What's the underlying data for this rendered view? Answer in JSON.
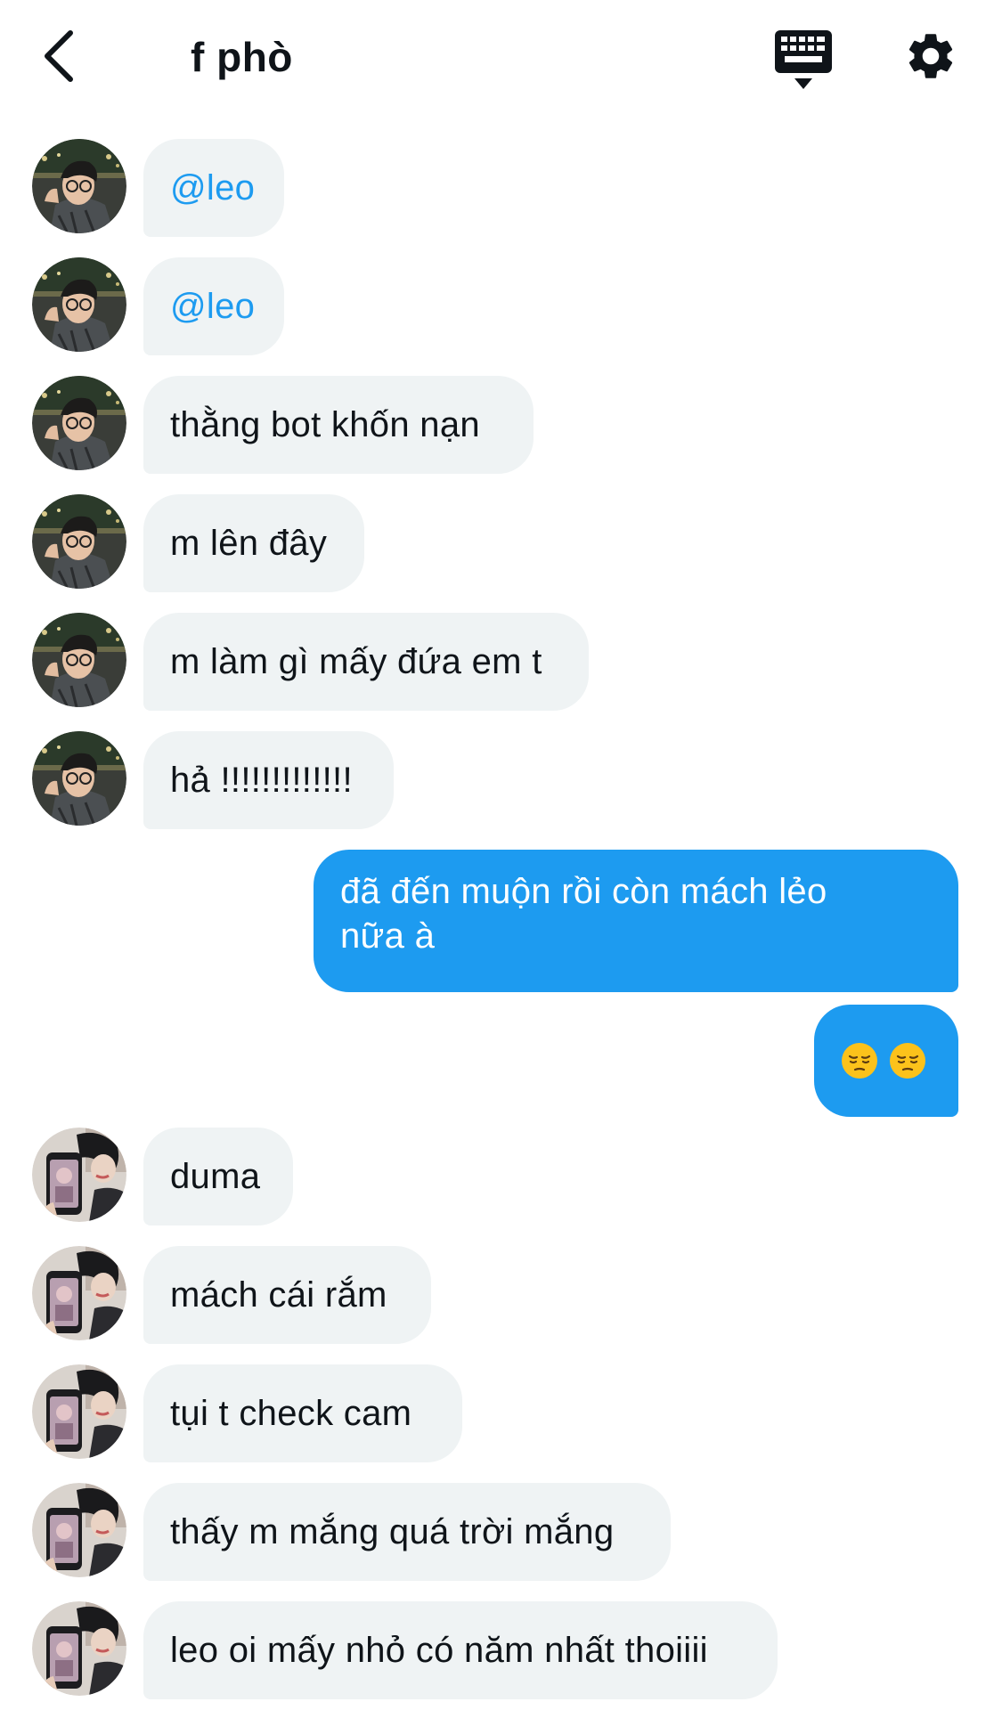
{
  "header": {
    "title": "f phò",
    "back_icon": "chevron-left-icon",
    "keyboard_icon": "keyboard-icon",
    "settings_icon": "gear-icon"
  },
  "colors": {
    "accent": "#1d9bf0",
    "incoming_bubble": "#eff3f4",
    "text": "#0f1419"
  },
  "messages": [
    {
      "from": "them",
      "avatar": "avatar-1",
      "text": "@leo"
    },
    {
      "from": "them",
      "avatar": "avatar-1",
      "text": "@leo"
    },
    {
      "from": "them",
      "avatar": "avatar-1",
      "text": "thằng bot khốn nạn"
    },
    {
      "from": "them",
      "avatar": "avatar-1",
      "text": "m lên đây"
    },
    {
      "from": "them",
      "avatar": "avatar-1",
      "text": "m làm gì mấy đứa em t"
    },
    {
      "from": "them",
      "avatar": "avatar-1",
      "text": "hả !!!!!!!!!!!!!"
    },
    {
      "from": "me",
      "text_line1": "đã đến muộn rồi còn mách lẻo",
      "text_line2": "nữa à"
    },
    {
      "from": "me",
      "emoji": [
        "pensive-face-icon",
        "pensive-face-icon"
      ]
    },
    {
      "from": "them",
      "avatar": "avatar-2",
      "text": "duma"
    },
    {
      "from": "them",
      "avatar": "avatar-2",
      "text": "mách cái rắm"
    },
    {
      "from": "them",
      "avatar": "avatar-2",
      "text": "tụi t check cam"
    },
    {
      "from": "them",
      "avatar": "avatar-2",
      "text": "thấy m mắng quá trời mắng"
    },
    {
      "from": "them",
      "avatar": "avatar-2",
      "text": "leo oi mấy nhỏ có năm nhất thoiiii"
    }
  ]
}
